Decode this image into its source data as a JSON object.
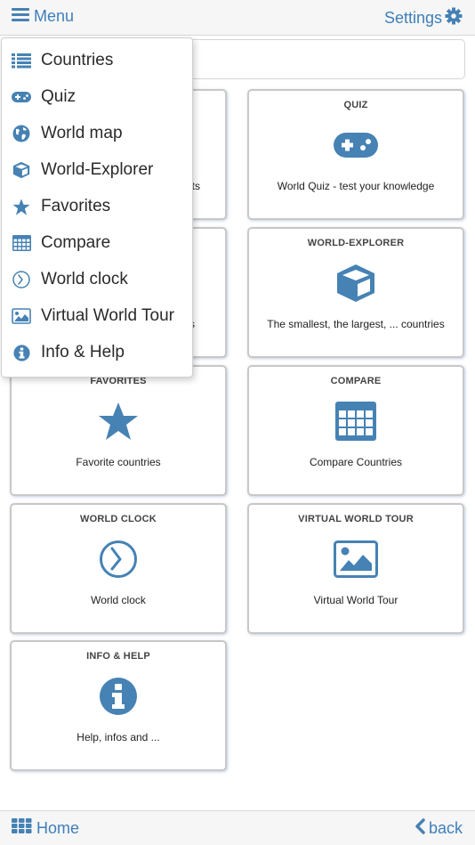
{
  "header": {
    "menu_label": "Menu",
    "settings_label": "Settings"
  },
  "search": {
    "placeholder": "",
    "value": ""
  },
  "menu": {
    "items": [
      {
        "label": "Countries",
        "icon": "list-icon"
      },
      {
        "label": "Quiz",
        "icon": "gamepad-icon"
      },
      {
        "label": "World map",
        "icon": "globe-icon"
      },
      {
        "label": "World-Explorer",
        "icon": "cube-icon"
      },
      {
        "label": "Favorites",
        "icon": "star-icon"
      },
      {
        "label": "Compare",
        "icon": "table-icon"
      },
      {
        "label": "World clock",
        "icon": "clock-icon"
      },
      {
        "label": "Virtual World Tour",
        "icon": "image-icon"
      },
      {
        "label": "Info & Help",
        "icon": "info-icon"
      }
    ]
  },
  "tiles": [
    {
      "title": "",
      "desc_fragment": "ts"
    },
    {
      "title": "QUIZ",
      "desc": "World Quiz - test your knowledge",
      "icon": "gamepad-icon"
    },
    {
      "title": "",
      "desc_fragment": "s"
    },
    {
      "title": "WORLD-EXPLORER",
      "desc": "The smallest, the largest, ... countries",
      "icon": "cube-icon"
    },
    {
      "title": "FAVORITES",
      "desc": "Favorite countries",
      "icon": "star-icon"
    },
    {
      "title": "COMPARE",
      "desc": "Compare Countries",
      "icon": "table-icon"
    },
    {
      "title": "WORLD CLOCK",
      "desc": "World clock",
      "icon": "clock-icon"
    },
    {
      "title": "VIRTUAL WORLD TOUR",
      "desc": "Virtual World Tour",
      "icon": "image-icon"
    },
    {
      "title": "INFO & HELP",
      "desc": "Help, infos and ...",
      "icon": "info-icon"
    }
  ],
  "footer": {
    "home_label": "Home",
    "back_label": "back"
  },
  "colors": {
    "accent": "#4682b4",
    "link": "#3f7fba",
    "bar_bg": "#f6f6f6"
  }
}
